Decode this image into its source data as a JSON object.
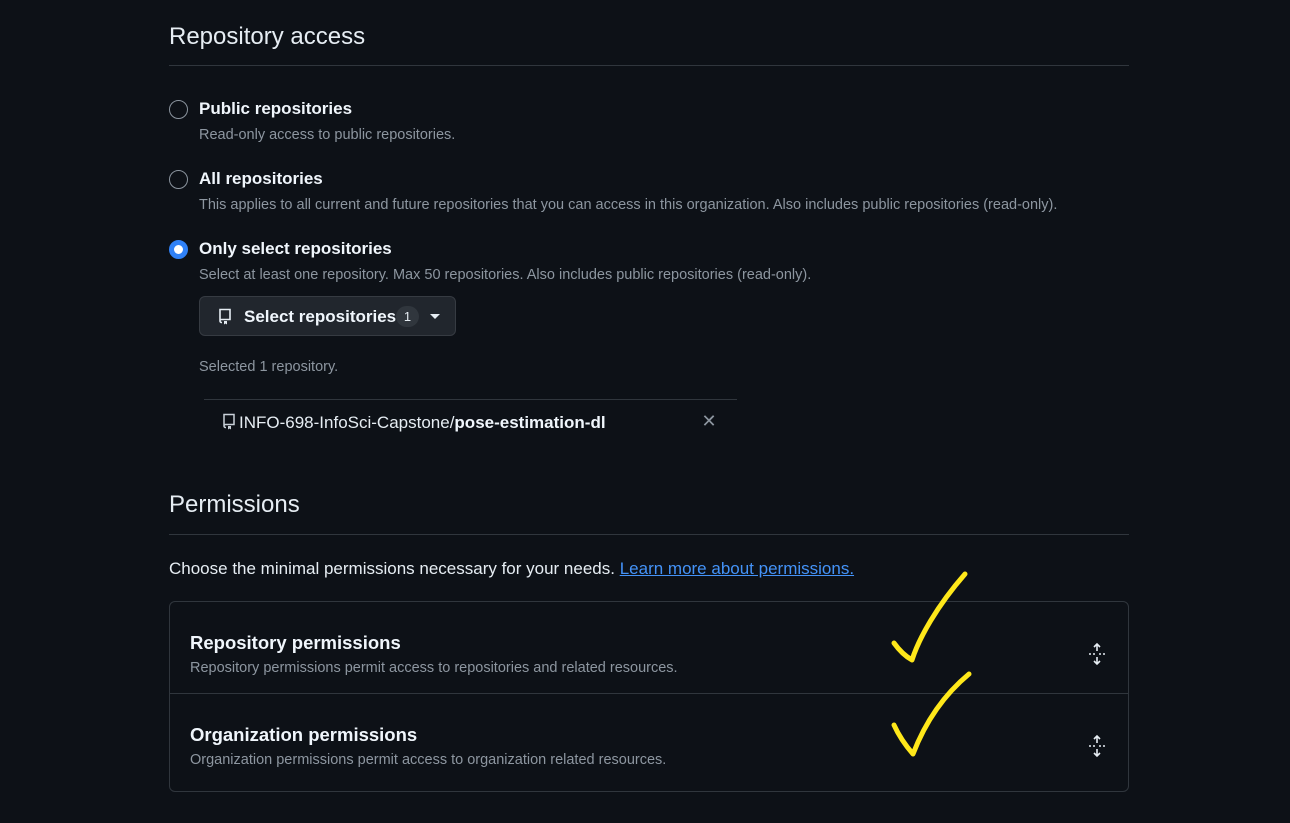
{
  "repository_access": {
    "heading": "Repository access",
    "options": [
      {
        "label": "Public repositories",
        "description": "Read-only access to public repositories.",
        "checked": false
      },
      {
        "label": "All repositories",
        "description": "This applies to all current and future repositories that you can access in this organization. Also includes public repositories (read-only).",
        "checked": false
      },
      {
        "label": "Only select repositories",
        "description": "Select at least one repository. Max 50 repositories. Also includes public repositories (read-only).",
        "checked": true
      }
    ],
    "select_button": {
      "label": "Select repositories",
      "count": "1",
      "icon": "repo-icon"
    },
    "selected_summary": "Selected 1 repository.",
    "selected_repos": [
      {
        "owner": "INFO-698-InfoSci-Capstone/",
        "name": "pose-estimation-dl",
        "remove_symbol": "✕"
      }
    ]
  },
  "permissions": {
    "heading": "Permissions",
    "intro": "Choose the minimal permissions necessary for your needs. ",
    "learn_more_link": "Learn more about permissions.",
    "sections": [
      {
        "title": "Repository permissions",
        "description": "Repository permissions permit access to repositories and related resources.",
        "icon": "unfold-icon"
      },
      {
        "title": "Organization permissions",
        "description": "Organization permissions permit access to organization related resources.",
        "icon": "unfold-icon"
      }
    ]
  },
  "annotation": {
    "color": "#ffe81a",
    "marks": [
      "checkmark",
      "checkmark"
    ]
  },
  "colors": {
    "background": "#0d1117",
    "accent": "#2f81f7",
    "link": "#4493f8",
    "border": "#30363d",
    "muted_text": "#8d96a0"
  }
}
